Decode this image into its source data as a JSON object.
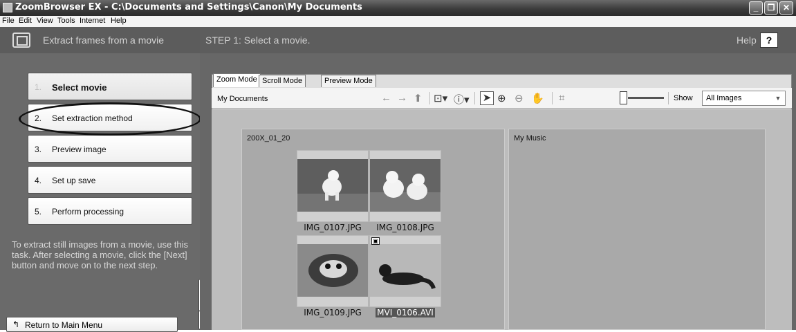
{
  "window": {
    "title": "ZoomBrowser EX  -  C:\\Documents and Settings\\Canon\\My Documents",
    "minimize_label": "_",
    "restore_label": "❐",
    "close_label": "✕"
  },
  "menu": [
    "File",
    "Edit",
    "View",
    "Tools",
    "Internet",
    "Help"
  ],
  "task_panel": {
    "header": "Extract frames from a movie",
    "steps": [
      {
        "num": "1.",
        "label": "Select movie"
      },
      {
        "num": "2.",
        "label": "Set extraction method"
      },
      {
        "num": "3.",
        "label": "Preview image"
      },
      {
        "num": "4.",
        "label": "Set up save"
      },
      {
        "num": "5.",
        "label": "Perform processing"
      }
    ],
    "description": "To extract still images from a movie, use this task. After selecting a movie, click the [Next] button and move on to the next step.",
    "return_button": "Return to Main Menu",
    "return_icon": "↰",
    "collapse_icon": "<"
  },
  "main": {
    "step_title": "STEP 1: Select a movie.",
    "help_label": "Help",
    "help_button": "?",
    "tabs": [
      "Zoom Mode",
      "Scroll Mode",
      "Preview Mode"
    ],
    "current_folder": "My Documents",
    "show_label": "Show",
    "show_value": "All Images",
    "folders": [
      {
        "name": "200X_01_20",
        "files": [
          "IMG_0107.JPG",
          "IMG_0108.JPG",
          "IMG_0109.JPG",
          "MVI_0106.AVI"
        ]
      },
      {
        "name": "My Music",
        "files": []
      }
    ],
    "toolbar_icons": [
      "back-arrow-icon",
      "forward-arrow-icon",
      "up-folder-icon",
      "select-menu-icon",
      "info-icon",
      "pointer-icon",
      "zoom-in-icon",
      "zoom-out-icon",
      "hand-icon",
      "fit-icon"
    ]
  },
  "annotation": {
    "highlighted_step": "2."
  }
}
